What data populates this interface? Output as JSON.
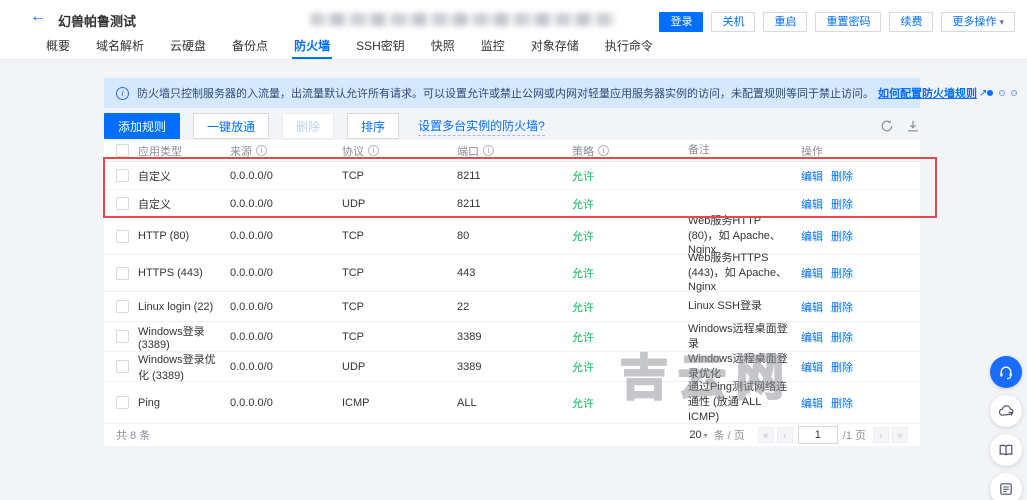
{
  "header": {
    "title": "幻兽帕鲁测试",
    "actions": [
      {
        "label": "登录",
        "primary": true
      },
      {
        "label": "关机"
      },
      {
        "label": "重启"
      },
      {
        "label": "重置密码"
      },
      {
        "label": "续费"
      },
      {
        "label": "更多操作",
        "dropdown": true
      }
    ]
  },
  "tabs": [
    {
      "label": "概要"
    },
    {
      "label": "域名解析"
    },
    {
      "label": "云硬盘"
    },
    {
      "label": "备份点"
    },
    {
      "label": "防火墙",
      "active": true
    },
    {
      "label": "SSH密钥"
    },
    {
      "label": "快照"
    },
    {
      "label": "监控"
    },
    {
      "label": "对象存储"
    },
    {
      "label": "执行命令"
    }
  ],
  "banner": {
    "text": "防火墙只控制服务器的入流量，出流量默认允许所有请求。可以设置允许或禁止公网或内网对轻量应用服务器实例的访问，未配置规则等同于禁止访问。",
    "link": "如何配置防火墙规则",
    "dots": [
      true,
      false,
      false
    ]
  },
  "toolbar": {
    "buttons": [
      {
        "label": "添加规则",
        "type": "primary"
      },
      {
        "label": "一键放通",
        "type": "default"
      },
      {
        "label": "删除",
        "type": "disabled"
      },
      {
        "label": "排序",
        "type": "default"
      }
    ],
    "link": "设置多台实例的防火墙?"
  },
  "table": {
    "columns": [
      {
        "label": "应用类型",
        "info": false
      },
      {
        "label": "来源",
        "info": true
      },
      {
        "label": "协议",
        "info": true
      },
      {
        "label": "端口",
        "info": true
      },
      {
        "label": "策略",
        "info": true
      },
      {
        "label": "备注",
        "info": false
      },
      {
        "label": "操作",
        "info": false
      }
    ],
    "row_actions": [
      "编辑",
      "删除"
    ],
    "rows": [
      {
        "app": "自定义",
        "source": "0.0.0.0/0",
        "protocol": "TCP",
        "port": "8211",
        "policy": "允许",
        "remark": ""
      },
      {
        "app": "自定义",
        "source": "0.0.0.0/0",
        "protocol": "UDP",
        "port": "8211",
        "policy": "允许",
        "remark": ""
      },
      {
        "app": "HTTP (80)",
        "source": "0.0.0.0/0",
        "protocol": "TCP",
        "port": "80",
        "policy": "允许",
        "remark": "Web服务HTTP (80)，如 Apache、Nginx"
      },
      {
        "app": "HTTPS (443)",
        "source": "0.0.0.0/0",
        "protocol": "TCP",
        "port": "443",
        "policy": "允许",
        "remark": "Web服务HTTPS (443)，如 Apache、Nginx"
      },
      {
        "app": "Linux login (22)",
        "source": "0.0.0.0/0",
        "protocol": "TCP",
        "port": "22",
        "policy": "允许",
        "remark": "Linux SSH登录"
      },
      {
        "app": "Windows登录 (3389)",
        "source": "0.0.0.0/0",
        "protocol": "TCP",
        "port": "3389",
        "policy": "允许",
        "remark": "Windows远程桌面登录"
      },
      {
        "app": "Windows登录优化 (3389)",
        "source": "0.0.0.0/0",
        "protocol": "UDP",
        "port": "3389",
        "policy": "允许",
        "remark": "Windows远程桌面登录优化"
      },
      {
        "app": "Ping",
        "source": "0.0.0.0/0",
        "protocol": "ICMP",
        "port": "ALL",
        "policy": "允许",
        "remark": "通过Ping测试网络连通性 (放通 ALL ICMP)"
      }
    ]
  },
  "footer": {
    "total": "共 8 条",
    "page_size": "20",
    "per_page": "条 / 页",
    "page": "1",
    "page_total": "/1 页"
  },
  "watermark": "吉云网",
  "floating": [
    {
      "icon": "headset",
      "name": "customer-service-button",
      "primary": true
    },
    {
      "icon": "cloud",
      "name": "cloud-button"
    },
    {
      "icon": "book",
      "name": "docs-button"
    },
    {
      "icon": "form",
      "name": "feedback-button"
    }
  ],
  "colors": {
    "accent": "#006eff",
    "allow_green": "#0abf5b",
    "highlight_red": "#e5484d",
    "banner_bg": "#d6e8fb"
  }
}
